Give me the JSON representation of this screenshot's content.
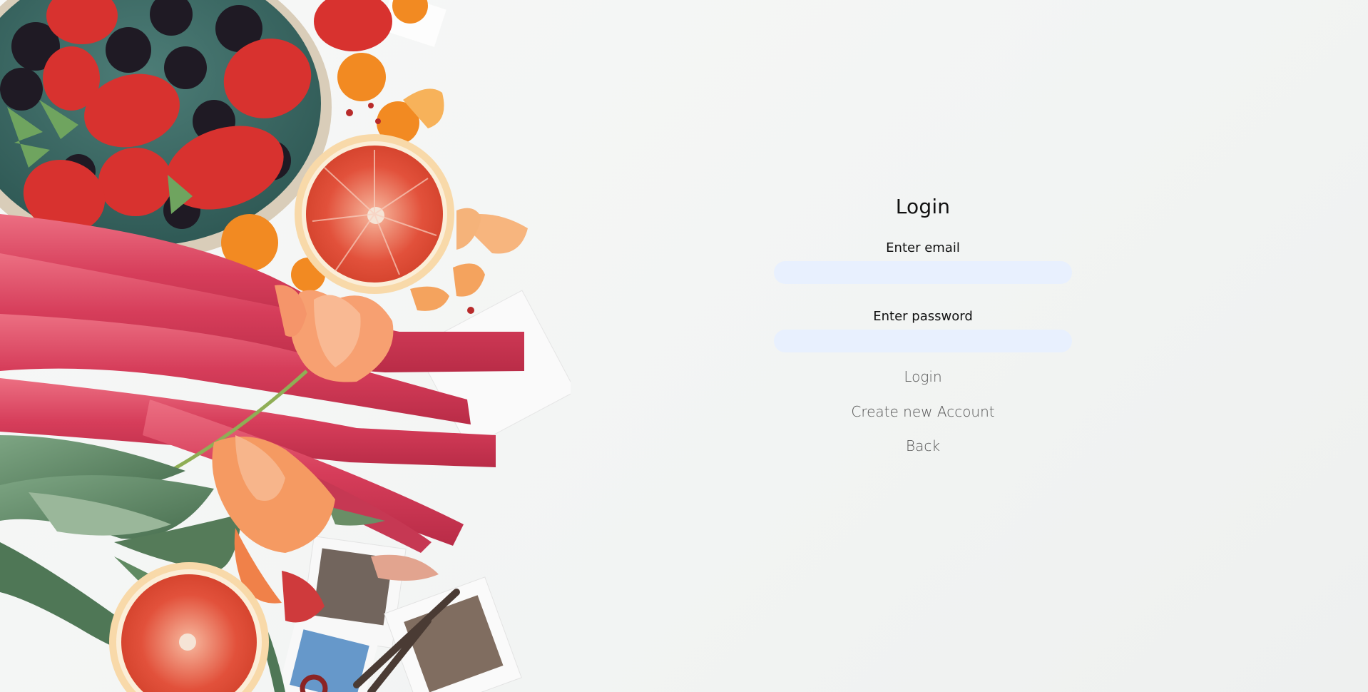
{
  "login": {
    "title": "Login",
    "email_label": "Enter email",
    "email_value": "",
    "password_label": "Enter password",
    "password_value": "",
    "login_button": "Login",
    "create_account_link": "Create new Account",
    "back_link": "Back"
  },
  "colors": {
    "background": "#f4f5f4",
    "input_fill": "#e8f0fe",
    "strawberry": "#d8322f",
    "blackberry": "#1f1a24",
    "rhubarb": "#d94461",
    "orange": "#f28a22",
    "leaf": "#5f8a65",
    "bowl": "#3b6b66"
  }
}
